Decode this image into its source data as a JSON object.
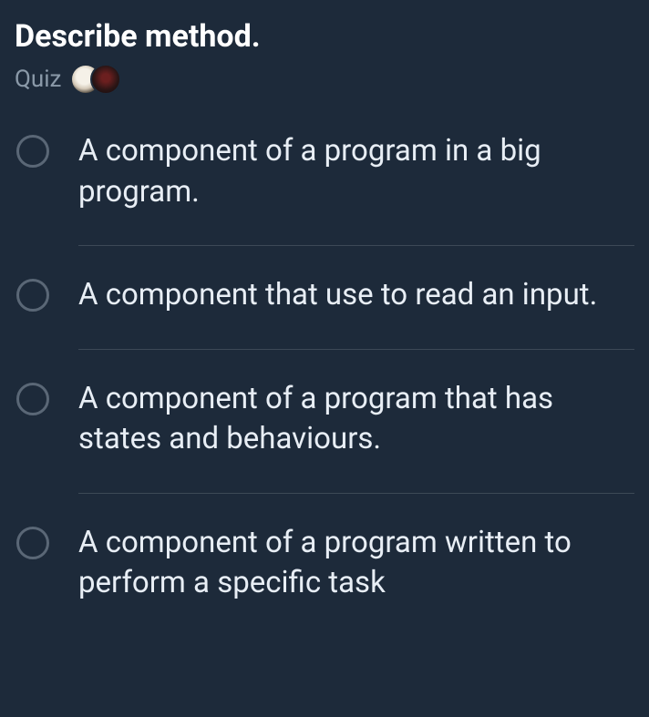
{
  "question": {
    "title": "Describe method.",
    "type_label": "Quiz"
  },
  "options": [
    {
      "text": "A component of a program in a big program."
    },
    {
      "text": "A component that use to read an input."
    },
    {
      "text": "A component of a program that has states and behaviours."
    },
    {
      "text": "A component of a program written to perform a specific task"
    }
  ]
}
